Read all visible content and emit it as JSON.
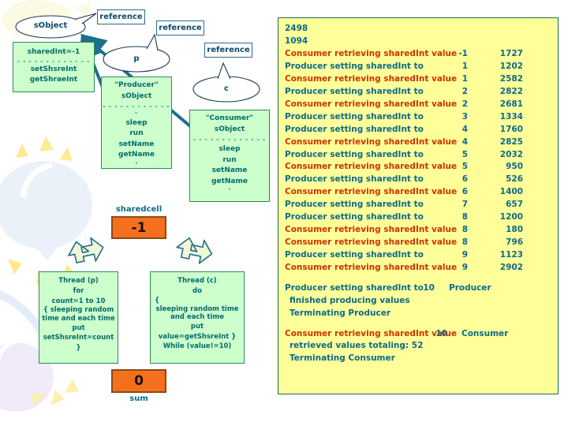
{
  "diagram": {
    "reference_labels": [
      "reference",
      "reference",
      "reference"
    ],
    "callouts": [
      {
        "name": "sobject-callout",
        "label": "sObject"
      },
      {
        "name": "p-callout",
        "label": "p"
      },
      {
        "name": "c-callout",
        "label": "c"
      }
    ],
    "shared_class_box": {
      "field": "sharedInt=-1",
      "divider": "- - - - - - - - - - - - -",
      "methods": [
        "setShsreInt",
        "getShraeInt"
      ]
    },
    "producer_box": {
      "title": "\"Producer\"",
      "subtitle": "sObject",
      "divider": "- - - - - - - - - - - - -",
      "methods": [
        "sleep",
        "run",
        "setName",
        "getName",
        "'"
      ]
    },
    "consumer_box": {
      "title": "\"Consumer\"",
      "subtitle": "sObject",
      "divider": "- - - - - - - - - - - - -",
      "methods": [
        "sleep",
        "run",
        "setName",
        "getName",
        "'"
      ]
    },
    "sharedcell": {
      "caption": "sharedcell",
      "value": "-1"
    },
    "sum": {
      "caption": "sum",
      "value": "0"
    },
    "thread_p": {
      "title": "Thread (p)",
      "lines": [
        "for",
        "count=1 to 10",
        "{  sleeping random",
        "time and each time",
        "put",
        "setShsreInt=count",
        "}"
      ]
    },
    "thread_c": {
      "title": "Thread (c)",
      "lines": [
        "do",
        "{",
        "sleeping random time",
        "and each time",
        "put",
        "value=getShsreInt }",
        "While (value!=10)"
      ]
    }
  },
  "console": {
    "header_numbers": [
      "2498",
      "1094"
    ],
    "rows": [
      {
        "kind": "consumer",
        "message": "Consumer retrieving sharedInt value",
        "value": "-1",
        "time": "1727"
      },
      {
        "kind": "producer",
        "message": "Producer setting sharedInt to",
        "value": "1",
        "time": "1202"
      },
      {
        "kind": "consumer",
        "message": "Consumer retrieving sharedInt value",
        "value": "1",
        "time": "2582"
      },
      {
        "kind": "producer",
        "message": "Producer setting sharedInt to",
        "value": "2",
        "time": "2822"
      },
      {
        "kind": "consumer",
        "message": "Consumer retrieving sharedInt value",
        "value": "2",
        "time": "2681"
      },
      {
        "kind": "producer",
        "message": "Producer setting sharedInt to",
        "value": "3",
        "time": "1334"
      },
      {
        "kind": "producer",
        "message": "Producer setting sharedInt to",
        "value": "4",
        "time": "1760"
      },
      {
        "kind": "consumer",
        "message": "Consumer retrieving sharedInt value",
        "value": "4",
        "time": "2825"
      },
      {
        "kind": "producer",
        "message": "Producer setting sharedInt to",
        "value": "5",
        "time": "2032"
      },
      {
        "kind": "consumer",
        "message": "Consumer retrieving sharedInt value",
        "value": "5",
        "time": "950"
      },
      {
        "kind": "producer",
        "message": "Producer setting sharedInt to",
        "value": "6",
        "time": "526"
      },
      {
        "kind": "consumer",
        "message": "Consumer retrieving sharedInt value",
        "value": "6",
        "time": "1400"
      },
      {
        "kind": "producer",
        "message": "Producer setting sharedInt to",
        "value": "7",
        "time": "657"
      },
      {
        "kind": "producer",
        "message": "Producer setting sharedInt to",
        "value": "8",
        "time": "1200"
      },
      {
        "kind": "consumer",
        "message": "Consumer retrieving sharedInt value",
        "value": "8",
        "time": "180"
      },
      {
        "kind": "consumer",
        "message": "Consumer retrieving sharedInt value",
        "value": "8",
        "time": "796"
      },
      {
        "kind": "producer",
        "message": "Producer setting sharedInt to",
        "value": "9",
        "time": "1123"
      },
      {
        "kind": "consumer",
        "message": "Consumer retrieving sharedInt value",
        "value": "9",
        "time": "2902"
      }
    ],
    "producer_summary": {
      "message": "Producer setting sharedInt to",
      "value": "10",
      "tag": "Producer",
      "line2": "finished producing values",
      "line3": "Terminating Producer"
    },
    "consumer_summary": {
      "message": "Consumer retrieving sharedInt value",
      "value": "10",
      "tag": "Consumer",
      "line2": "retrieved values totaling: 52",
      "line3": "Terminating Consumer"
    }
  },
  "colors": {
    "console_bg": "#ffff99",
    "console_border": "#1f6b5a",
    "producer_text": "#0b6a8a",
    "consumer_text": "#cc3300",
    "green_box": "#ccffcc",
    "green_border": "#2e8b57",
    "orange_box": "#f4701d",
    "arrow_teal": "#1f6e8c"
  }
}
